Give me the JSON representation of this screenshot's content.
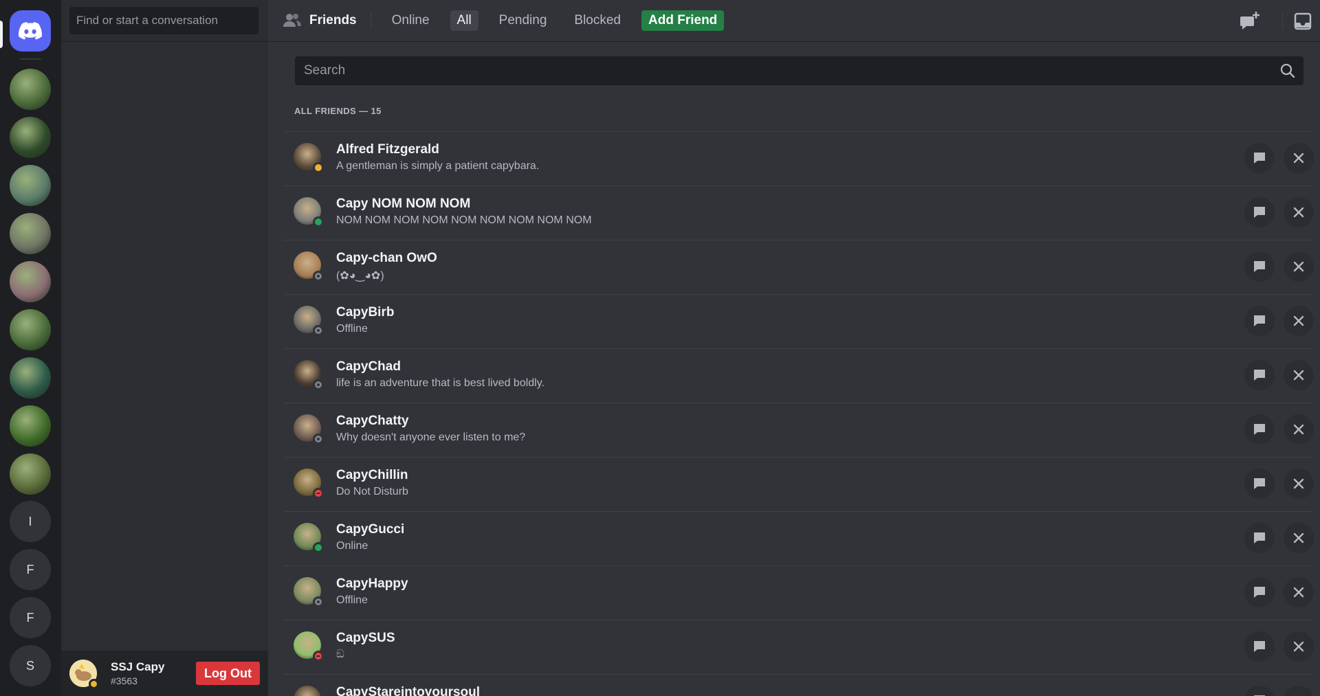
{
  "rail": {
    "servers": [
      {
        "name": "server-1",
        "color": "#4b6b3a"
      },
      {
        "name": "server-2",
        "color": "#2f4a2a"
      },
      {
        "name": "server-3",
        "color": "#5b7c6a"
      },
      {
        "name": "server-4",
        "color": "#6f7466"
      },
      {
        "name": "server-5",
        "color": "#8a6d74"
      },
      {
        "name": "server-6",
        "color": "#4a6b3a"
      },
      {
        "name": "server-7",
        "color": "#2d5a4a"
      },
      {
        "name": "server-8",
        "color": "#3f6b2a"
      },
      {
        "name": "server-9",
        "color": "#5a6b3a"
      }
    ],
    "letters": [
      "I",
      "F",
      "F",
      "S"
    ]
  },
  "dm": {
    "search_placeholder": "Find or start a conversation"
  },
  "user": {
    "name": "SSJ Capy",
    "tag": "#3563",
    "logout_label": "Log Out"
  },
  "header": {
    "title": "Friends",
    "tabs": [
      "Online",
      "All",
      "Pending",
      "Blocked"
    ],
    "active_tab": "All",
    "add_friend_label": "Add Friend"
  },
  "main": {
    "search_placeholder": "Search",
    "section_title": "ALL FRIENDS — 15"
  },
  "friends": [
    {
      "name": "Alfred Fitzgerald",
      "status_text": "A gentleman is simply a patient capybara.",
      "presence": "idle",
      "avatar_color": "#5b4a3a"
    },
    {
      "name": "Capy NOM NOM NOM",
      "status_text": "NOM NOM NOM NOM NOM NOM NOM NOM NOM",
      "presence": "online",
      "avatar_color": "#7d7d7a"
    },
    {
      "name": "Capy-chan OwO",
      "status_text": "(✿◕‿◕✿)",
      "presence": "offline",
      "avatar_color": "#a87e55"
    },
    {
      "name": "CapyBirb",
      "status_text": "Offline",
      "presence": "offline",
      "avatar_color": "#6a6a66"
    },
    {
      "name": "CapyChad",
      "status_text": "life is an adventure that is best lived boldly.",
      "presence": "offline",
      "avatar_color": "#4a3a30"
    },
    {
      "name": "CapyChatty",
      "status_text": "Why doesn't anyone ever listen to me?",
      "presence": "offline",
      "avatar_color": "#6e5a52"
    },
    {
      "name": "CapyChillin",
      "status_text": "Do Not Disturb",
      "presence": "dnd",
      "avatar_color": "#7a6a3a"
    },
    {
      "name": "CapyGucci",
      "status_text": "Online",
      "presence": "online",
      "avatar_color": "#6f8a55"
    },
    {
      "name": "CapyHappy",
      "status_text": "Offline",
      "presence": "offline",
      "avatar_color": "#7c8a60"
    },
    {
      "name": "CapySUS",
      "status_text": "ඞ",
      "presence": "dnd",
      "avatar_color": "#8fbf6a"
    },
    {
      "name": "CapyStareintoyoursoul",
      "status_text": "",
      "presence": "offline",
      "avatar_color": "#5a4a3a"
    }
  ]
}
